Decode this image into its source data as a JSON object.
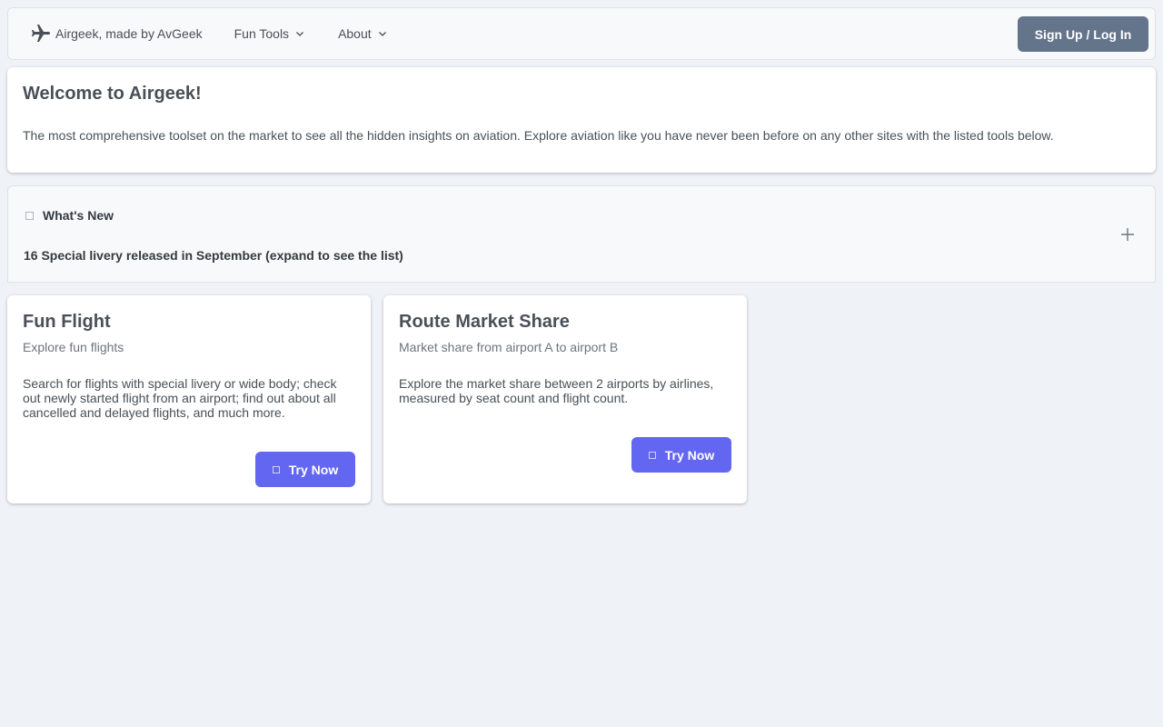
{
  "navbar": {
    "brand": "Airgeek, made by AvGeek",
    "menu": [
      {
        "label": "Fun Tools"
      },
      {
        "label": "About"
      }
    ],
    "signup_label": "Sign Up / Log In"
  },
  "welcome": {
    "title": "Welcome to Airgeek!",
    "text": "The most comprehensive toolset on the market to see all the hidden insights on aviation. Explore aviation like you have never been before on any other sites with the listed tools below."
  },
  "whats_new": {
    "title": "What's New",
    "summary": "16 Special livery released in September (expand to see the list)"
  },
  "cards": [
    {
      "title": "Fun Flight",
      "subtitle": "Explore fun flights",
      "description": "Search for flights with special livery or wide body; check out newly started flight from an airport; find out about all cancelled and delayed flights, and much more.",
      "button": "Try Now"
    },
    {
      "title": "Route Market Share",
      "subtitle": "Market share from airport A to airport B",
      "description": "Explore the market share between 2 airports by airlines, measured by seat count and flight count.",
      "button": "Try Now"
    }
  ],
  "icons": {
    "brand": "airplane-icon",
    "dropdown": "chevron-down-icon",
    "expand": "plus-icon"
  },
  "colors": {
    "primary_button": "#6366f1",
    "signup_button": "#64748b",
    "background": "#eff2f7"
  }
}
